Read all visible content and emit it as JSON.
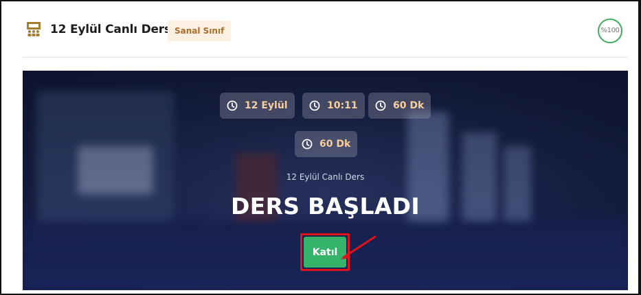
{
  "header": {
    "title": "12 Eylül Canlı Ders",
    "badge": "Sanal Sınıf",
    "progress_label": "%100",
    "progress_value": 100,
    "title_icon": "classroom-icon"
  },
  "hero": {
    "info_pills": [
      {
        "icon": "clock-icon",
        "label": "12 Eylül"
      },
      {
        "icon": "clock-icon",
        "label": "10:11"
      },
      {
        "icon": "clock-icon",
        "label": "60 Dk"
      },
      {
        "icon": "clock-icon",
        "label": "60 Dk"
      }
    ],
    "subtitle": "12 Eylül Canlı Ders",
    "status": "DERS BAŞLADI",
    "join_label": "Katıl"
  },
  "colors": {
    "accent": "#36b36a",
    "badge_text": "#a96f2a",
    "badge_bg": "#fbf0e2",
    "pill_text": "#f7cf9c",
    "highlight": "#e0131b",
    "icon": "#a67c2e"
  }
}
